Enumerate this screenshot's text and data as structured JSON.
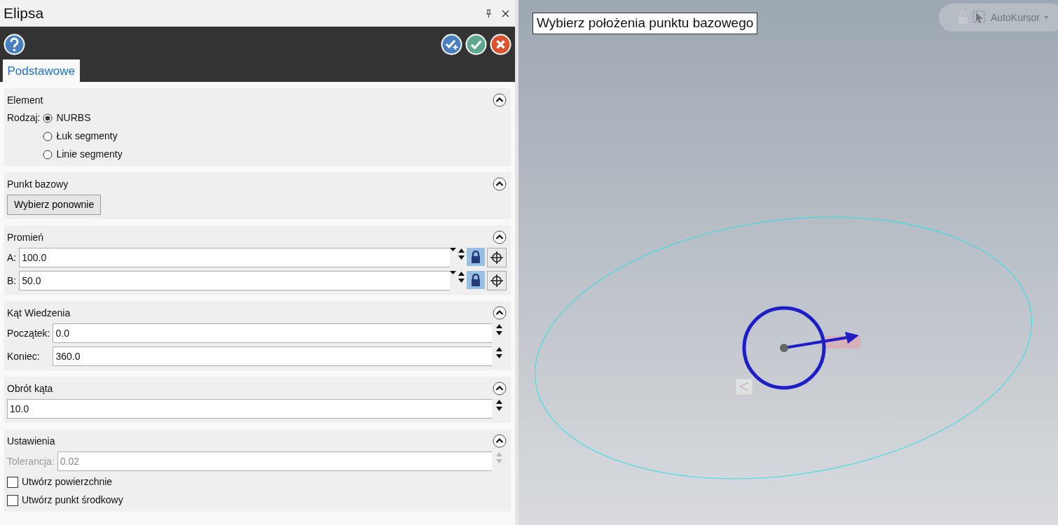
{
  "window": {
    "title": "Elipsa"
  },
  "tabs": [
    {
      "label": "Podstawowe",
      "selected": true
    }
  ],
  "sections": [
    {
      "title": "Element",
      "expanded": true,
      "rows": [
        {
          "kind": "radio",
          "label": "Rodzaj:",
          "text": "NURBS",
          "selected": true
        },
        {
          "kind": "radio",
          "text": "Łuk segmenty",
          "selected": false
        },
        {
          "kind": "radio",
          "text": "Linie segmenty",
          "selected": false
        }
      ]
    },
    {
      "title": "Punkt bazowy",
      "expanded": true,
      "rows": [
        {
          "kind": "button",
          "text": "Wybierz ponownie"
        }
      ]
    },
    {
      "title": "Promień",
      "expanded": true,
      "rows": [
        {
          "kind": "dimension",
          "label": "A:",
          "value": "100.0",
          "locked": true
        },
        {
          "kind": "dimension",
          "label": "B:",
          "value": "50.0",
          "locked": true
        }
      ]
    },
    {
      "title": "Kąt Wiedzenia",
      "expanded": true,
      "rows": [
        {
          "kind": "spin",
          "label": "Początek:",
          "value": "0.0",
          "disabled": false
        },
        {
          "kind": "spin",
          "label": "Koniec:",
          "value": "360.0",
          "disabled": false
        }
      ]
    },
    {
      "title": "Obrót kąta",
      "expanded": true,
      "rows": [
        {
          "kind": "spin",
          "value": "10.0",
          "disabled": false
        }
      ]
    },
    {
      "title": "Ustawienia",
      "expanded": true,
      "rows": [
        {
          "kind": "spin",
          "label": "Tolerancja:",
          "value": "0.02",
          "disabled": true
        },
        {
          "kind": "checkbox",
          "text": "Utwórz powierzchnie",
          "checked": false
        },
        {
          "kind": "checkbox",
          "text": "Utwórz punkt środkowy",
          "checked": false
        }
      ]
    }
  ],
  "viewport": {
    "prompt": "Wybierz położenia punktu bazowego",
    "autocursor": "AutoKursor"
  }
}
